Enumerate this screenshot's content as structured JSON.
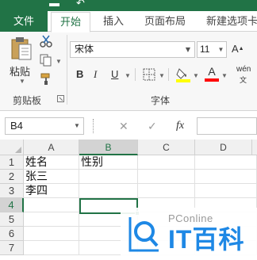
{
  "ribbon_tabs": {
    "file": "文件",
    "home": "开始",
    "insert": "插入",
    "page_layout": "页面布局",
    "new_tab": "新建选项卡"
  },
  "clipboard": {
    "paste_label": "粘贴",
    "group_label": "剪贴板"
  },
  "font": {
    "name": "宋体",
    "size": "11",
    "group_label": "字体",
    "bold": "B",
    "italic": "I",
    "underline": "U",
    "phonetic": "wén"
  },
  "formula_bar": {
    "name_box": "B4",
    "fx_label": "fx",
    "formula": ""
  },
  "grid": {
    "columns": [
      "A",
      "B",
      "C",
      "D"
    ],
    "selected_column": "B",
    "rows": [
      "1",
      "2",
      "3",
      "4",
      "5",
      "6",
      "7"
    ],
    "selected_row": "4",
    "cells": [
      {
        "ref": "A1",
        "value": "姓名"
      },
      {
        "ref": "B1",
        "value": "性别"
      },
      {
        "ref": "A2",
        "value": "张三"
      },
      {
        "ref": "A3",
        "value": "李四"
      }
    ]
  },
  "watermark": {
    "small": "PConline",
    "big": "IT百科"
  },
  "colors": {
    "excel_green": "#217346",
    "highlight_yellow": "#ffff00",
    "font_red": "#ff0000",
    "watermark_blue": "#1e88e5"
  }
}
